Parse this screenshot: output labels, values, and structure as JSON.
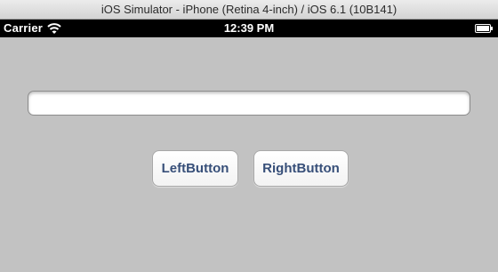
{
  "window": {
    "title": "iOS Simulator - iPhone (Retina 4-inch) / iOS 6.1 (10B141)"
  },
  "status_bar": {
    "carrier": "Carrier",
    "time": "12:39 PM",
    "wifi_icon": "wifi-icon",
    "battery_icon": "battery-icon"
  },
  "main": {
    "text_field": {
      "value": "",
      "placeholder": ""
    },
    "buttons": {
      "left_label": "LeftButton",
      "right_label": "RightButton"
    }
  },
  "colors": {
    "background": "#c2c2c2",
    "button_text": "#374f79",
    "status_bar": "#000000"
  }
}
